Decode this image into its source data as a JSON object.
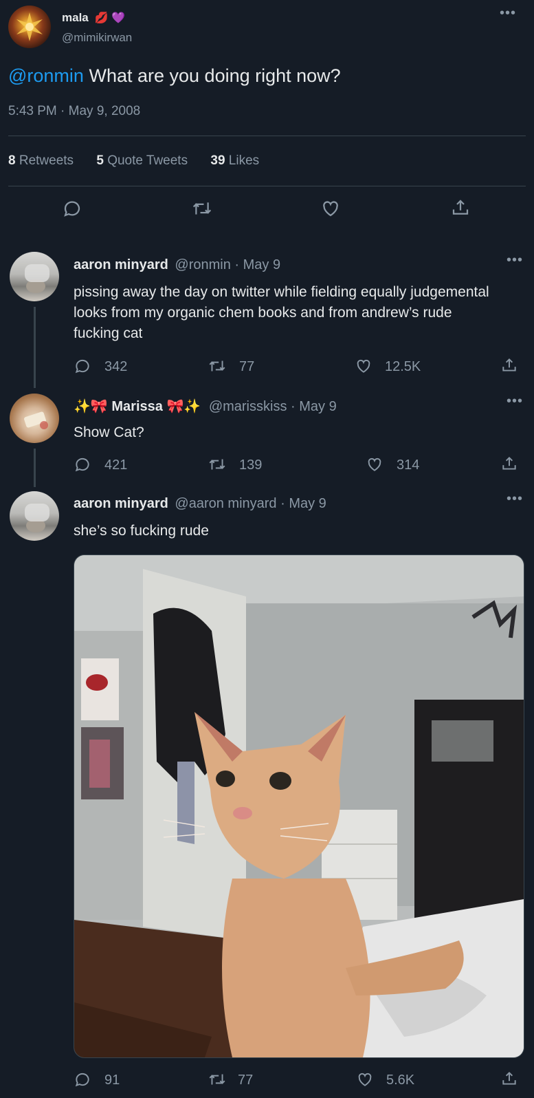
{
  "main_tweet": {
    "display_name": "mala",
    "name_emojis": [
      "💋",
      "💜"
    ],
    "handle": "@mimikirwan",
    "mention": "@ronmin",
    "text": "What are you doing right now?",
    "timestamp": "5:43 PM · May 9, 2008",
    "retweets_count": "8",
    "retweets_label": "Retweets",
    "quotes_count": "5",
    "quotes_label": "Quote Tweets",
    "likes_count": "39",
    "likes_label": "Likes"
  },
  "replies": [
    {
      "display_name": "aaron minyard",
      "handle": "@ronmin",
      "date": "· May 9",
      "text": "pissing away the day on twitter while fielding equally judgemental looks from my organic chem books and from andrew’s rude fucking cat",
      "replies": "342",
      "retweets": "77",
      "likes": "12.5K"
    },
    {
      "name_prefix": "✨🎀",
      "display_name": "Marissa",
      "name_suffix": "🎀✨",
      "handle": "@marisskiss",
      "date": "· May 9",
      "text": "Show Cat?",
      "replies": "421",
      "retweets": "139",
      "likes": "314"
    },
    {
      "display_name": "aaron minyard",
      "handle": "@aaron minyard",
      "date": "· May 9",
      "text": "she’s so fucking rude",
      "replies": "91",
      "retweets": "77",
      "likes": "5.6K"
    }
  ],
  "icons": {
    "more": "more-icon",
    "reply": "reply-icon",
    "retweet": "retweet-icon",
    "like": "heart-icon",
    "share": "share-icon"
  },
  "colors": {
    "background": "#151c26",
    "link": "#1d9bf0",
    "muted": "#8b98a5",
    "divider": "#38444d"
  }
}
